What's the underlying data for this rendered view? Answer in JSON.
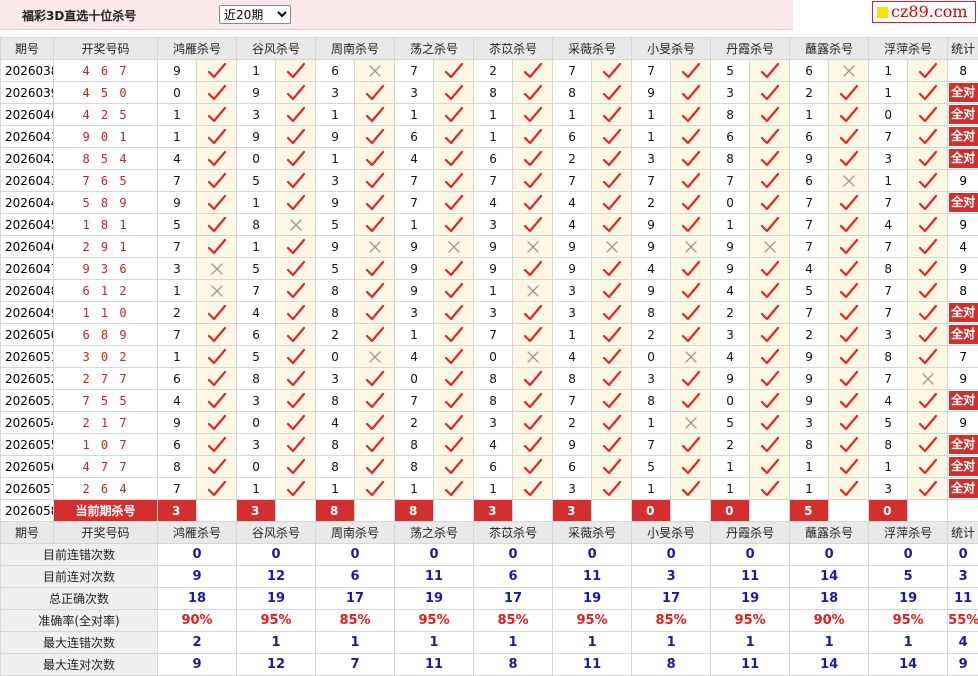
{
  "header": {
    "title": "福彩3D直选十位杀号",
    "period_selected": "近20期",
    "logo": "cz89.com"
  },
  "columns": {
    "issue": "期号",
    "draw": "开奖号码",
    "experts": [
      "鸿雁杀号",
      "谷风杀号",
      "周南杀号",
      "荡之杀号",
      "苶苡杀号",
      "采薇杀号",
      "小旻杀号",
      "丹霞杀号",
      "蘸露杀号",
      "浮萍杀号"
    ],
    "stat": "统计"
  },
  "rows": [
    {
      "issue": "2026038",
      "draw": "4 6 7",
      "kills": [
        "9",
        "1",
        "6",
        "7",
        "2",
        "7",
        "7",
        "5",
        "6",
        "1"
      ],
      "hits": [
        1,
        1,
        0,
        1,
        1,
        1,
        1,
        1,
        0,
        1
      ],
      "stat": "8"
    },
    {
      "issue": "2026039",
      "draw": "4 5 0",
      "kills": [
        "0",
        "9",
        "3",
        "3",
        "8",
        "8",
        "9",
        "3",
        "2",
        "1"
      ],
      "hits": [
        1,
        1,
        1,
        1,
        1,
        1,
        1,
        1,
        1,
        1
      ],
      "stat": "全对"
    },
    {
      "issue": "2026040",
      "draw": "4 2 5",
      "kills": [
        "1",
        "3",
        "1",
        "1",
        "1",
        "1",
        "1",
        "8",
        "1",
        "0"
      ],
      "hits": [
        1,
        1,
        1,
        1,
        1,
        1,
        1,
        1,
        1,
        1
      ],
      "stat": "全对"
    },
    {
      "issue": "2026041",
      "draw": "9 0 1",
      "kills": [
        "1",
        "9",
        "9",
        "6",
        "1",
        "6",
        "1",
        "6",
        "6",
        "7"
      ],
      "hits": [
        1,
        1,
        1,
        1,
        1,
        1,
        1,
        1,
        1,
        1
      ],
      "stat": "全对"
    },
    {
      "issue": "2026042",
      "draw": "8 5 4",
      "kills": [
        "4",
        "0",
        "1",
        "4",
        "6",
        "2",
        "3",
        "8",
        "9",
        "3"
      ],
      "hits": [
        1,
        1,
        1,
        1,
        1,
        1,
        1,
        1,
        1,
        1
      ],
      "stat": "全对"
    },
    {
      "issue": "2026043",
      "draw": "7 6 5",
      "kills": [
        "7",
        "5",
        "3",
        "7",
        "7",
        "7",
        "7",
        "7",
        "6",
        "1"
      ],
      "hits": [
        1,
        1,
        1,
        1,
        1,
        1,
        1,
        1,
        0,
        1
      ],
      "stat": "9"
    },
    {
      "issue": "2026044",
      "draw": "5 8 9",
      "kills": [
        "9",
        "1",
        "9",
        "7",
        "4",
        "4",
        "2",
        "0",
        "7",
        "7"
      ],
      "hits": [
        1,
        1,
        1,
        1,
        1,
        1,
        1,
        1,
        1,
        1
      ],
      "stat": "全对"
    },
    {
      "issue": "2026045",
      "draw": "1 8 1",
      "kills": [
        "5",
        "8",
        "5",
        "1",
        "3",
        "4",
        "9",
        "1",
        "7",
        "4"
      ],
      "hits": [
        1,
        0,
        1,
        1,
        1,
        1,
        1,
        1,
        1,
        1
      ],
      "stat": "9"
    },
    {
      "issue": "2026046",
      "draw": "2 9 1",
      "kills": [
        "7",
        "1",
        "9",
        "9",
        "9",
        "9",
        "9",
        "9",
        "7",
        "7"
      ],
      "hits": [
        1,
        1,
        0,
        0,
        0,
        0,
        0,
        0,
        1,
        1
      ],
      "stat": "4"
    },
    {
      "issue": "2026047",
      "draw": "9 3 6",
      "kills": [
        "3",
        "5",
        "5",
        "9",
        "9",
        "9",
        "4",
        "9",
        "4",
        "8"
      ],
      "hits": [
        0,
        1,
        1,
        1,
        1,
        1,
        1,
        1,
        1,
        1
      ],
      "stat": "9"
    },
    {
      "issue": "2026048",
      "draw": "6 1 2",
      "kills": [
        "1",
        "7",
        "8",
        "9",
        "1",
        "3",
        "9",
        "4",
        "5",
        "7"
      ],
      "hits": [
        0,
        1,
        1,
        1,
        0,
        1,
        1,
        1,
        1,
        1
      ],
      "stat": "8"
    },
    {
      "issue": "2026049",
      "draw": "1 1 0",
      "kills": [
        "2",
        "4",
        "8",
        "3",
        "3",
        "3",
        "8",
        "2",
        "7",
        "7"
      ],
      "hits": [
        1,
        1,
        1,
        1,
        1,
        1,
        1,
        1,
        1,
        1
      ],
      "stat": "全对"
    },
    {
      "issue": "2026050",
      "draw": "6 8 9",
      "kills": [
        "7",
        "6",
        "2",
        "1",
        "7",
        "1",
        "2",
        "3",
        "2",
        "3"
      ],
      "hits": [
        1,
        1,
        1,
        1,
        1,
        1,
        1,
        1,
        1,
        1
      ],
      "stat": "全对"
    },
    {
      "issue": "2026051",
      "draw": "3 0 2",
      "kills": [
        "1",
        "5",
        "0",
        "4",
        "0",
        "4",
        "0",
        "4",
        "9",
        "8"
      ],
      "hits": [
        1,
        1,
        0,
        1,
        0,
        1,
        0,
        1,
        1,
        1
      ],
      "stat": "7"
    },
    {
      "issue": "2026052",
      "draw": "2 7 7",
      "kills": [
        "6",
        "8",
        "3",
        "0",
        "8",
        "8",
        "3",
        "9",
        "9",
        "7"
      ],
      "hits": [
        1,
        1,
        1,
        1,
        1,
        1,
        1,
        1,
        1,
        0
      ],
      "stat": "9"
    },
    {
      "issue": "2026053",
      "draw": "7 5 5",
      "kills": [
        "4",
        "3",
        "8",
        "7",
        "8",
        "7",
        "8",
        "0",
        "9",
        "4"
      ],
      "hits": [
        1,
        1,
        1,
        1,
        1,
        1,
        1,
        1,
        1,
        1
      ],
      "stat": "全对"
    },
    {
      "issue": "2026054",
      "draw": "2 1 7",
      "kills": [
        "9",
        "0",
        "4",
        "2",
        "3",
        "2",
        "1",
        "5",
        "3",
        "5"
      ],
      "hits": [
        1,
        1,
        1,
        1,
        1,
        1,
        0,
        1,
        1,
        1
      ],
      "stat": "9"
    },
    {
      "issue": "2026055",
      "draw": "1 0 7",
      "kills": [
        "6",
        "3",
        "8",
        "8",
        "4",
        "9",
        "7",
        "2",
        "8",
        "8"
      ],
      "hits": [
        1,
        1,
        1,
        1,
        1,
        1,
        1,
        1,
        1,
        1
      ],
      "stat": "全对"
    },
    {
      "issue": "2026056",
      "draw": "4 7 7",
      "kills": [
        "8",
        "0",
        "8",
        "8",
        "6",
        "6",
        "5",
        "1",
        "1",
        "1"
      ],
      "hits": [
        1,
        1,
        1,
        1,
        1,
        1,
        1,
        1,
        1,
        1
      ],
      "stat": "全对"
    },
    {
      "issue": "2026057",
      "draw": "2 6 4",
      "kills": [
        "7",
        "1",
        "1",
        "1",
        "1",
        "3",
        "1",
        "1",
        "1",
        "3"
      ],
      "hits": [
        1,
        1,
        1,
        1,
        1,
        1,
        1,
        1,
        1,
        1
      ],
      "stat": "全对"
    }
  ],
  "current": {
    "issue": "2026058",
    "label": "当前期杀号",
    "kills": [
      "3",
      "3",
      "8",
      "8",
      "3",
      "3",
      "0",
      "0",
      "5",
      "0"
    ]
  },
  "stats_labels": [
    "目前连错次数",
    "目前连对次数",
    "总正确次数",
    "准确率(全对率)",
    "最大连错次数",
    "最大连对次数"
  ],
  "stats": [
    [
      "0",
      "0",
      "0",
      "0",
      "0",
      "0",
      "0",
      "0",
      "0",
      "0",
      "0"
    ],
    [
      "9",
      "12",
      "6",
      "11",
      "6",
      "11",
      "3",
      "11",
      "14",
      "5",
      "3"
    ],
    [
      "18",
      "19",
      "17",
      "19",
      "17",
      "19",
      "17",
      "19",
      "18",
      "19",
      "11"
    ],
    [
      "90%",
      "95%",
      "85%",
      "95%",
      "85%",
      "95%",
      "85%",
      "95%",
      "90%",
      "95%",
      "55%"
    ],
    [
      "2",
      "1",
      "1",
      "1",
      "1",
      "1",
      "1",
      "1",
      "1",
      "1",
      "4"
    ],
    [
      "9",
      "12",
      "7",
      "11",
      "8",
      "11",
      "8",
      "11",
      "14",
      "14",
      "9"
    ]
  ],
  "colors": {
    "hit": "#e8232b",
    "miss": "#9a9a9a",
    "stat_all_bg": "#d32f2f",
    "rate": "#e31c1c",
    "stat_value": "#1a1aa8"
  }
}
